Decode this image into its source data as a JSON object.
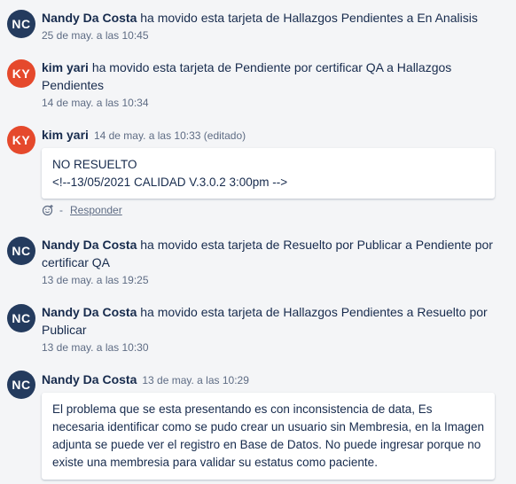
{
  "colors": {
    "nc_avatar": "#243b5e",
    "ky_avatar": "#e5492c"
  },
  "entries": [
    {
      "initials": "NC",
      "author": "Nandy Da Costa",
      "action": " ha movido esta tarjeta de Hallazgos Pendientes a En Analisis",
      "timestamp": "25 de may. a las 10:45"
    },
    {
      "initials": "KY",
      "author": "kim yari",
      "action": " ha movido esta tarjeta de Pendiente por certificar QA a Hallazgos Pendientes",
      "timestamp": "14 de may. a las 10:34"
    },
    {
      "initials": "KY",
      "author": "kim yari",
      "timestamp": "14 de may. a las 10:33 (editado)",
      "comment_lines": [
        "NO RESUELTO",
        "<!--13/05/2021 CALIDAD V.3.0.2 3:00pm -->"
      ],
      "reaction_icon": "smiley-add-icon",
      "separator": "-",
      "reply_label": "Responder"
    },
    {
      "initials": "NC",
      "author": "Nandy Da Costa",
      "action": " ha movido esta tarjeta de Resuelto por Publicar a Pendiente por certificar QA",
      "timestamp": "13 de may. a las 19:25"
    },
    {
      "initials": "NC",
      "author": "Nandy Da Costa",
      "action": " ha movido esta tarjeta de Hallazgos Pendientes a Resuelto por Publicar",
      "timestamp": "13 de may. a las 10:30"
    },
    {
      "initials": "NC",
      "author": "Nandy Da Costa",
      "timestamp": "13 de may. a las 10:29",
      "comment_text": "El problema que se esta presentando es con inconsistencia de data, Es necesaria identificar como se pudo crear un usuario sin Membresia, en la Imagen adjunta se puede ver el registro en Base de Datos. No puede ingresar porque no existe una membresia para validar su estatus como paciente."
    }
  ]
}
